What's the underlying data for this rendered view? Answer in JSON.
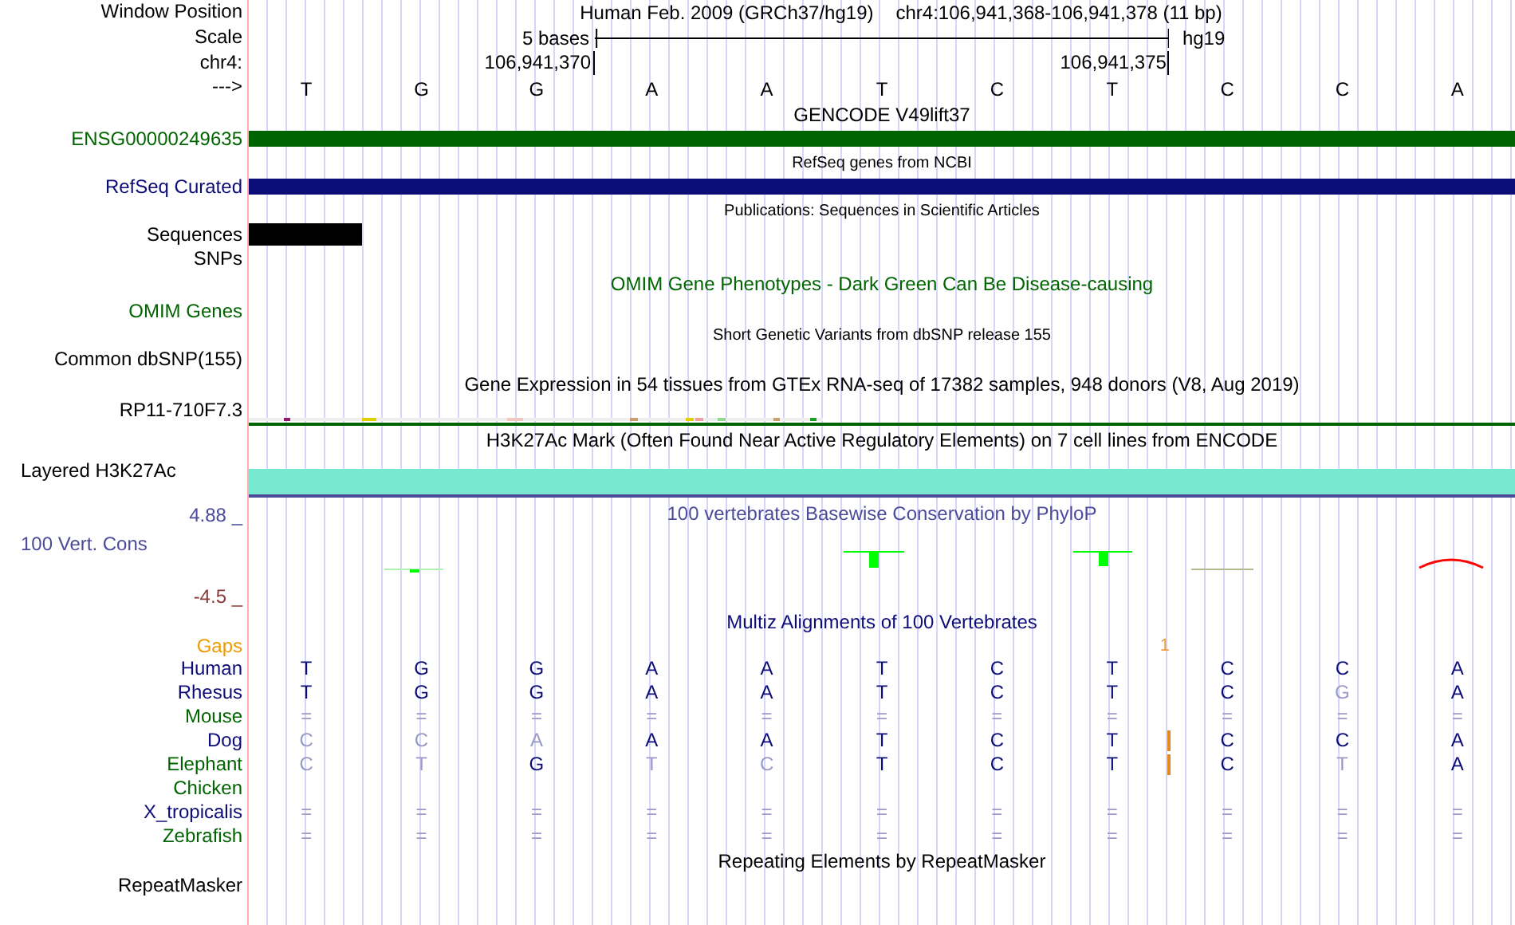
{
  "header": {
    "label": "Window Position",
    "title": "Human Feb. 2009 (GRCh37/hg19)",
    "range": "chr4:106,941,368-106,941,378 (11 bp)"
  },
  "scale": {
    "label": "Scale",
    "span": "5 bases",
    "assembly": "hg19"
  },
  "coordinates": {
    "label": "chr4:",
    "start": "106,941,370",
    "end": "106,941,375"
  },
  "sequence": {
    "label": "--->",
    "bases": [
      "T",
      "G",
      "G",
      "A",
      "A",
      "T",
      "C",
      "T",
      "C",
      "C",
      "A"
    ]
  },
  "tracks": [
    {
      "kind": "gene",
      "title": "GENCODE V49lift37",
      "label": "ENSG00000249635",
      "color": "#006400"
    },
    {
      "kind": "gene",
      "title": "RefSeq genes from NCBI",
      "label": "RefSeq Curated",
      "color": "#0c0c78"
    },
    {
      "kind": "publications",
      "title": "Publications: Sequences in Scientific Articles",
      "label": "Sequences",
      "second_label": "SNPs",
      "color": "#000000"
    },
    {
      "kind": "omim",
      "title": "OMIM Gene Phenotypes - Dark Green Can Be Disease-causing",
      "label": "OMIM Genes",
      "color": "#006400"
    },
    {
      "kind": "dbsnp",
      "title": "Short Genetic Variants from dbSNP release 155",
      "label": "Common dbSNP(155)",
      "color": "#000000"
    },
    {
      "kind": "gtex",
      "title": "Gene Expression in 54 tissues from GTEx RNA-seq of 17382 samples, 948 donors (V8, Aug 2019)",
      "label": "RP11-710F7.3",
      "color": "#000000"
    },
    {
      "kind": "h3k27ac",
      "title": "H3K27Ac Mark (Often Found Near Active Regulatory Elements) on 7 cell lines from ENCODE",
      "label": "Layered H3K27Ac",
      "color": "#000000"
    },
    {
      "kind": "phylop",
      "title": "100 vertebrates Basewise Conservation by PhyloP",
      "label": "100 Vert. Cons",
      "max": "4.88 _",
      "min": "-4.5 _",
      "color": "#4b4b9a"
    },
    {
      "kind": "multiz",
      "title": "Multiz Alignments of 100 Vertebrates",
      "gaps_label": "Gaps",
      "gap_count": "1",
      "color": "#0c0c78",
      "species": [
        {
          "name": "Human",
          "color": "#0c0c78",
          "bases": [
            {
              "b": "T",
              "faint": false
            },
            {
              "b": "G",
              "faint": false
            },
            {
              "b": "G",
              "faint": false
            },
            {
              "b": "A",
              "faint": false
            },
            {
              "b": "A",
              "faint": false
            },
            {
              "b": "T",
              "faint": false
            },
            {
              "b": "C",
              "faint": false
            },
            {
              "b": "T",
              "faint": false
            },
            {
              "b": "C",
              "faint": false
            },
            {
              "b": "C",
              "faint": false
            },
            {
              "b": "A",
              "faint": false
            }
          ]
        },
        {
          "name": "Rhesus",
          "color": "#0c0c78",
          "bases": [
            {
              "b": "T",
              "faint": false
            },
            {
              "b": "G",
              "faint": false
            },
            {
              "b": "G",
              "faint": false
            },
            {
              "b": "A",
              "faint": false
            },
            {
              "b": "A",
              "faint": false
            },
            {
              "b": "T",
              "faint": false
            },
            {
              "b": "C",
              "faint": false
            },
            {
              "b": "T",
              "faint": false
            },
            {
              "b": "C",
              "faint": false
            },
            {
              "b": "G",
              "faint": true
            },
            {
              "b": "A",
              "faint": false
            }
          ]
        },
        {
          "name": "Mouse",
          "color": "#006400",
          "bases": [
            {
              "b": "=",
              "faint": true
            },
            {
              "b": "=",
              "faint": true
            },
            {
              "b": "=",
              "faint": true
            },
            {
              "b": "=",
              "faint": true
            },
            {
              "b": "=",
              "faint": true
            },
            {
              "b": "=",
              "faint": true
            },
            {
              "b": "=",
              "faint": true
            },
            {
              "b": "=",
              "faint": true
            },
            {
              "b": "=",
              "faint": true
            },
            {
              "b": "=",
              "faint": true
            },
            {
              "b": "=",
              "faint": true
            }
          ]
        },
        {
          "name": "Dog",
          "color": "#0c0c78",
          "bases": [
            {
              "b": "C",
              "faint": true
            },
            {
              "b": "C",
              "faint": true
            },
            {
              "b": "A",
              "faint": true
            },
            {
              "b": "A",
              "faint": false
            },
            {
              "b": "A",
              "faint": false
            },
            {
              "b": "T",
              "faint": false
            },
            {
              "b": "C",
              "faint": false
            },
            {
              "b": "T",
              "faint": false,
              "insertion_after": true
            },
            {
              "b": "C",
              "faint": false
            },
            {
              "b": "C",
              "faint": false
            },
            {
              "b": "A",
              "faint": false
            }
          ]
        },
        {
          "name": "Elephant",
          "color": "#006400",
          "bases": [
            {
              "b": "C",
              "faint": true
            },
            {
              "b": "T",
              "faint": true
            },
            {
              "b": "G",
              "faint": false
            },
            {
              "b": "T",
              "faint": true
            },
            {
              "b": "C",
              "faint": true
            },
            {
              "b": "T",
              "faint": false
            },
            {
              "b": "C",
              "faint": false
            },
            {
              "b": "T",
              "faint": false,
              "insertion_after": true
            },
            {
              "b": "C",
              "faint": false
            },
            {
              "b": "T",
              "faint": true
            },
            {
              "b": "A",
              "faint": false
            }
          ]
        },
        {
          "name": "Chicken",
          "color": "#006400"
        },
        {
          "name": "X_tropicalis",
          "color": "#0c0c78",
          "bases": [
            {
              "b": "=",
              "faint": true
            },
            {
              "b": "=",
              "faint": true
            },
            {
              "b": "=",
              "faint": true
            },
            {
              "b": "=",
              "faint": true
            },
            {
              "b": "=",
              "faint": true
            },
            {
              "b": "=",
              "faint": true
            },
            {
              "b": "=",
              "faint": true
            },
            {
              "b": "=",
              "faint": true
            },
            {
              "b": "=",
              "faint": true
            },
            {
              "b": "=",
              "faint": true
            },
            {
              "b": "=",
              "faint": true
            }
          ]
        },
        {
          "name": "Zebrafish",
          "color": "#006400",
          "bases": [
            {
              "b": "=",
              "faint": true
            },
            {
              "b": "=",
              "faint": true
            },
            {
              "b": "=",
              "faint": true
            },
            {
              "b": "=",
              "faint": true
            },
            {
              "b": "=",
              "faint": true
            },
            {
              "b": "=",
              "faint": true
            },
            {
              "b": "=",
              "faint": true
            },
            {
              "b": "=",
              "faint": true
            },
            {
              "b": "=",
              "faint": true
            },
            {
              "b": "=",
              "faint": true
            },
            {
              "b": "=",
              "faint": true
            }
          ]
        }
      ]
    },
    {
      "kind": "repeat",
      "title": "Repeating Elements by RepeatMasker",
      "label": "RepeatMasker",
      "color": "#000000"
    }
  ]
}
